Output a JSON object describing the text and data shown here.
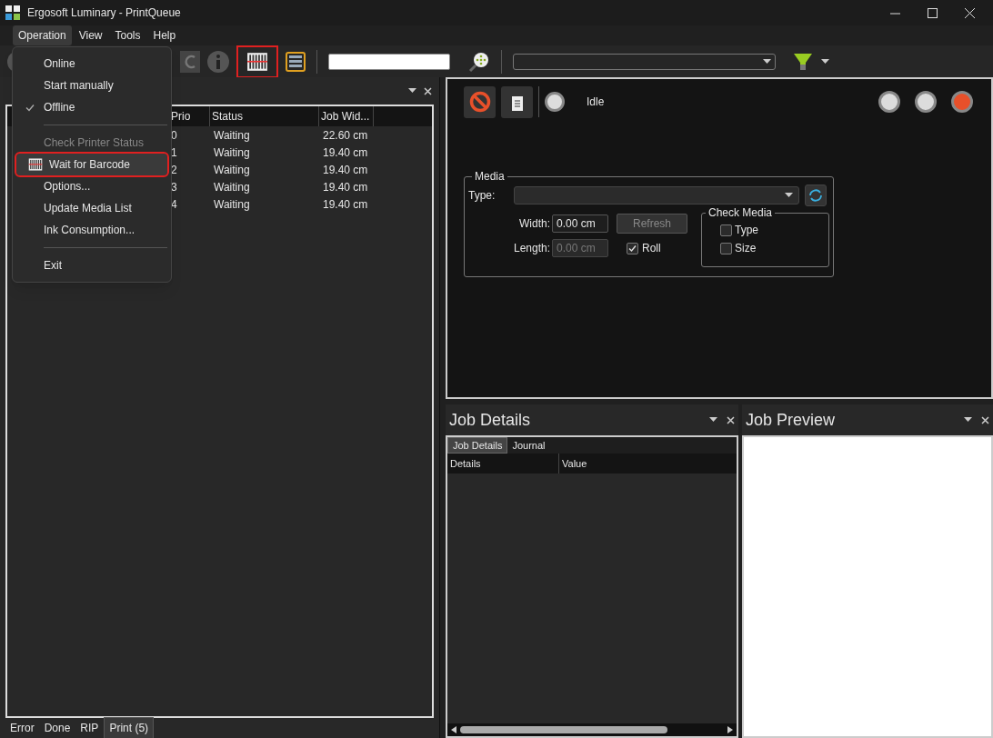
{
  "window": {
    "title": "Ergosoft Luminary - PrintQueue"
  },
  "menu_bar": [
    {
      "label": "Operation",
      "selected": true
    },
    {
      "label": "View",
      "selected": false
    },
    {
      "label": "Tools",
      "selected": false
    },
    {
      "label": "Help",
      "selected": false
    }
  ],
  "operation_menu": [
    {
      "kind": "item",
      "label": "Online",
      "checked": false,
      "disabled": false,
      "selected": false,
      "annotated": false
    },
    {
      "kind": "item",
      "label": "Start manually",
      "checked": false,
      "disabled": false,
      "selected": false,
      "annotated": false
    },
    {
      "kind": "item",
      "label": "Offline",
      "checked": true,
      "disabled": false,
      "selected": false,
      "annotated": false
    },
    {
      "kind": "separator"
    },
    {
      "kind": "item",
      "label": "Check Printer Status",
      "checked": false,
      "disabled": true,
      "selected": false,
      "annotated": false
    },
    {
      "kind": "barcode",
      "label": "Wait for Barcode",
      "checked": false,
      "disabled": false,
      "selected": true,
      "annotated": true
    },
    {
      "kind": "item",
      "label": "Options...",
      "checked": false,
      "disabled": false,
      "selected": false,
      "annotated": false
    },
    {
      "kind": "item",
      "label": "Update Media List",
      "checked": false,
      "disabled": false,
      "selected": false,
      "annotated": false
    },
    {
      "kind": "item",
      "label": "Ink Consumption...",
      "checked": false,
      "disabled": false,
      "selected": false,
      "annotated": false
    },
    {
      "kind": "separator"
    },
    {
      "kind": "item",
      "label": "Exit",
      "checked": false,
      "disabled": false,
      "selected": false,
      "annotated": false
    }
  ],
  "toolbar": {
    "barcode_annotated": true
  },
  "queue_panel": {
    "columns": [
      "Prio",
      "Status",
      "Job Wid..."
    ],
    "rows": [
      {
        "prio": "0",
        "status": "Waiting",
        "width": "22.60 cm"
      },
      {
        "prio": "1",
        "status": "Waiting",
        "width": "19.40 cm"
      },
      {
        "prio": "2",
        "status": "Waiting",
        "width": "19.40 cm"
      },
      {
        "prio": "3",
        "status": "Waiting",
        "width": "19.40 cm"
      },
      {
        "prio": "4",
        "status": "Waiting",
        "width": "19.40 cm"
      }
    ],
    "tabs": [
      {
        "label": "Error",
        "selected": false
      },
      {
        "label": "Done",
        "selected": false
      },
      {
        "label": "RIP",
        "selected": false
      },
      {
        "label": "Print (5)",
        "selected": true
      }
    ]
  },
  "printer": {
    "status": "Idle",
    "lights": [
      {
        "color": "#dcdcdc"
      },
      {
        "color": "#dcdcdc"
      },
      {
        "color": "#e8502a"
      }
    ],
    "media": {
      "title": "Media",
      "type_label": "Type:",
      "width_label": "Width:",
      "width": "0.00 cm",
      "length_label": "Length:",
      "length": "0.00 cm",
      "refresh": "Refresh",
      "roll": {
        "label": "Roll",
        "checked": true
      },
      "check_media": {
        "title": "Check Media",
        "options": [
          {
            "label": "Type",
            "checked": false
          },
          {
            "label": "Size",
            "checked": false
          }
        ]
      }
    }
  },
  "job_details": {
    "title": "Job Details",
    "tabs": [
      {
        "label": "Job Details",
        "selected": true
      },
      {
        "label": "Journal",
        "selected": false
      }
    ],
    "columns": [
      "Details",
      "Value"
    ]
  },
  "job_preview": {
    "title": "Job Preview"
  }
}
